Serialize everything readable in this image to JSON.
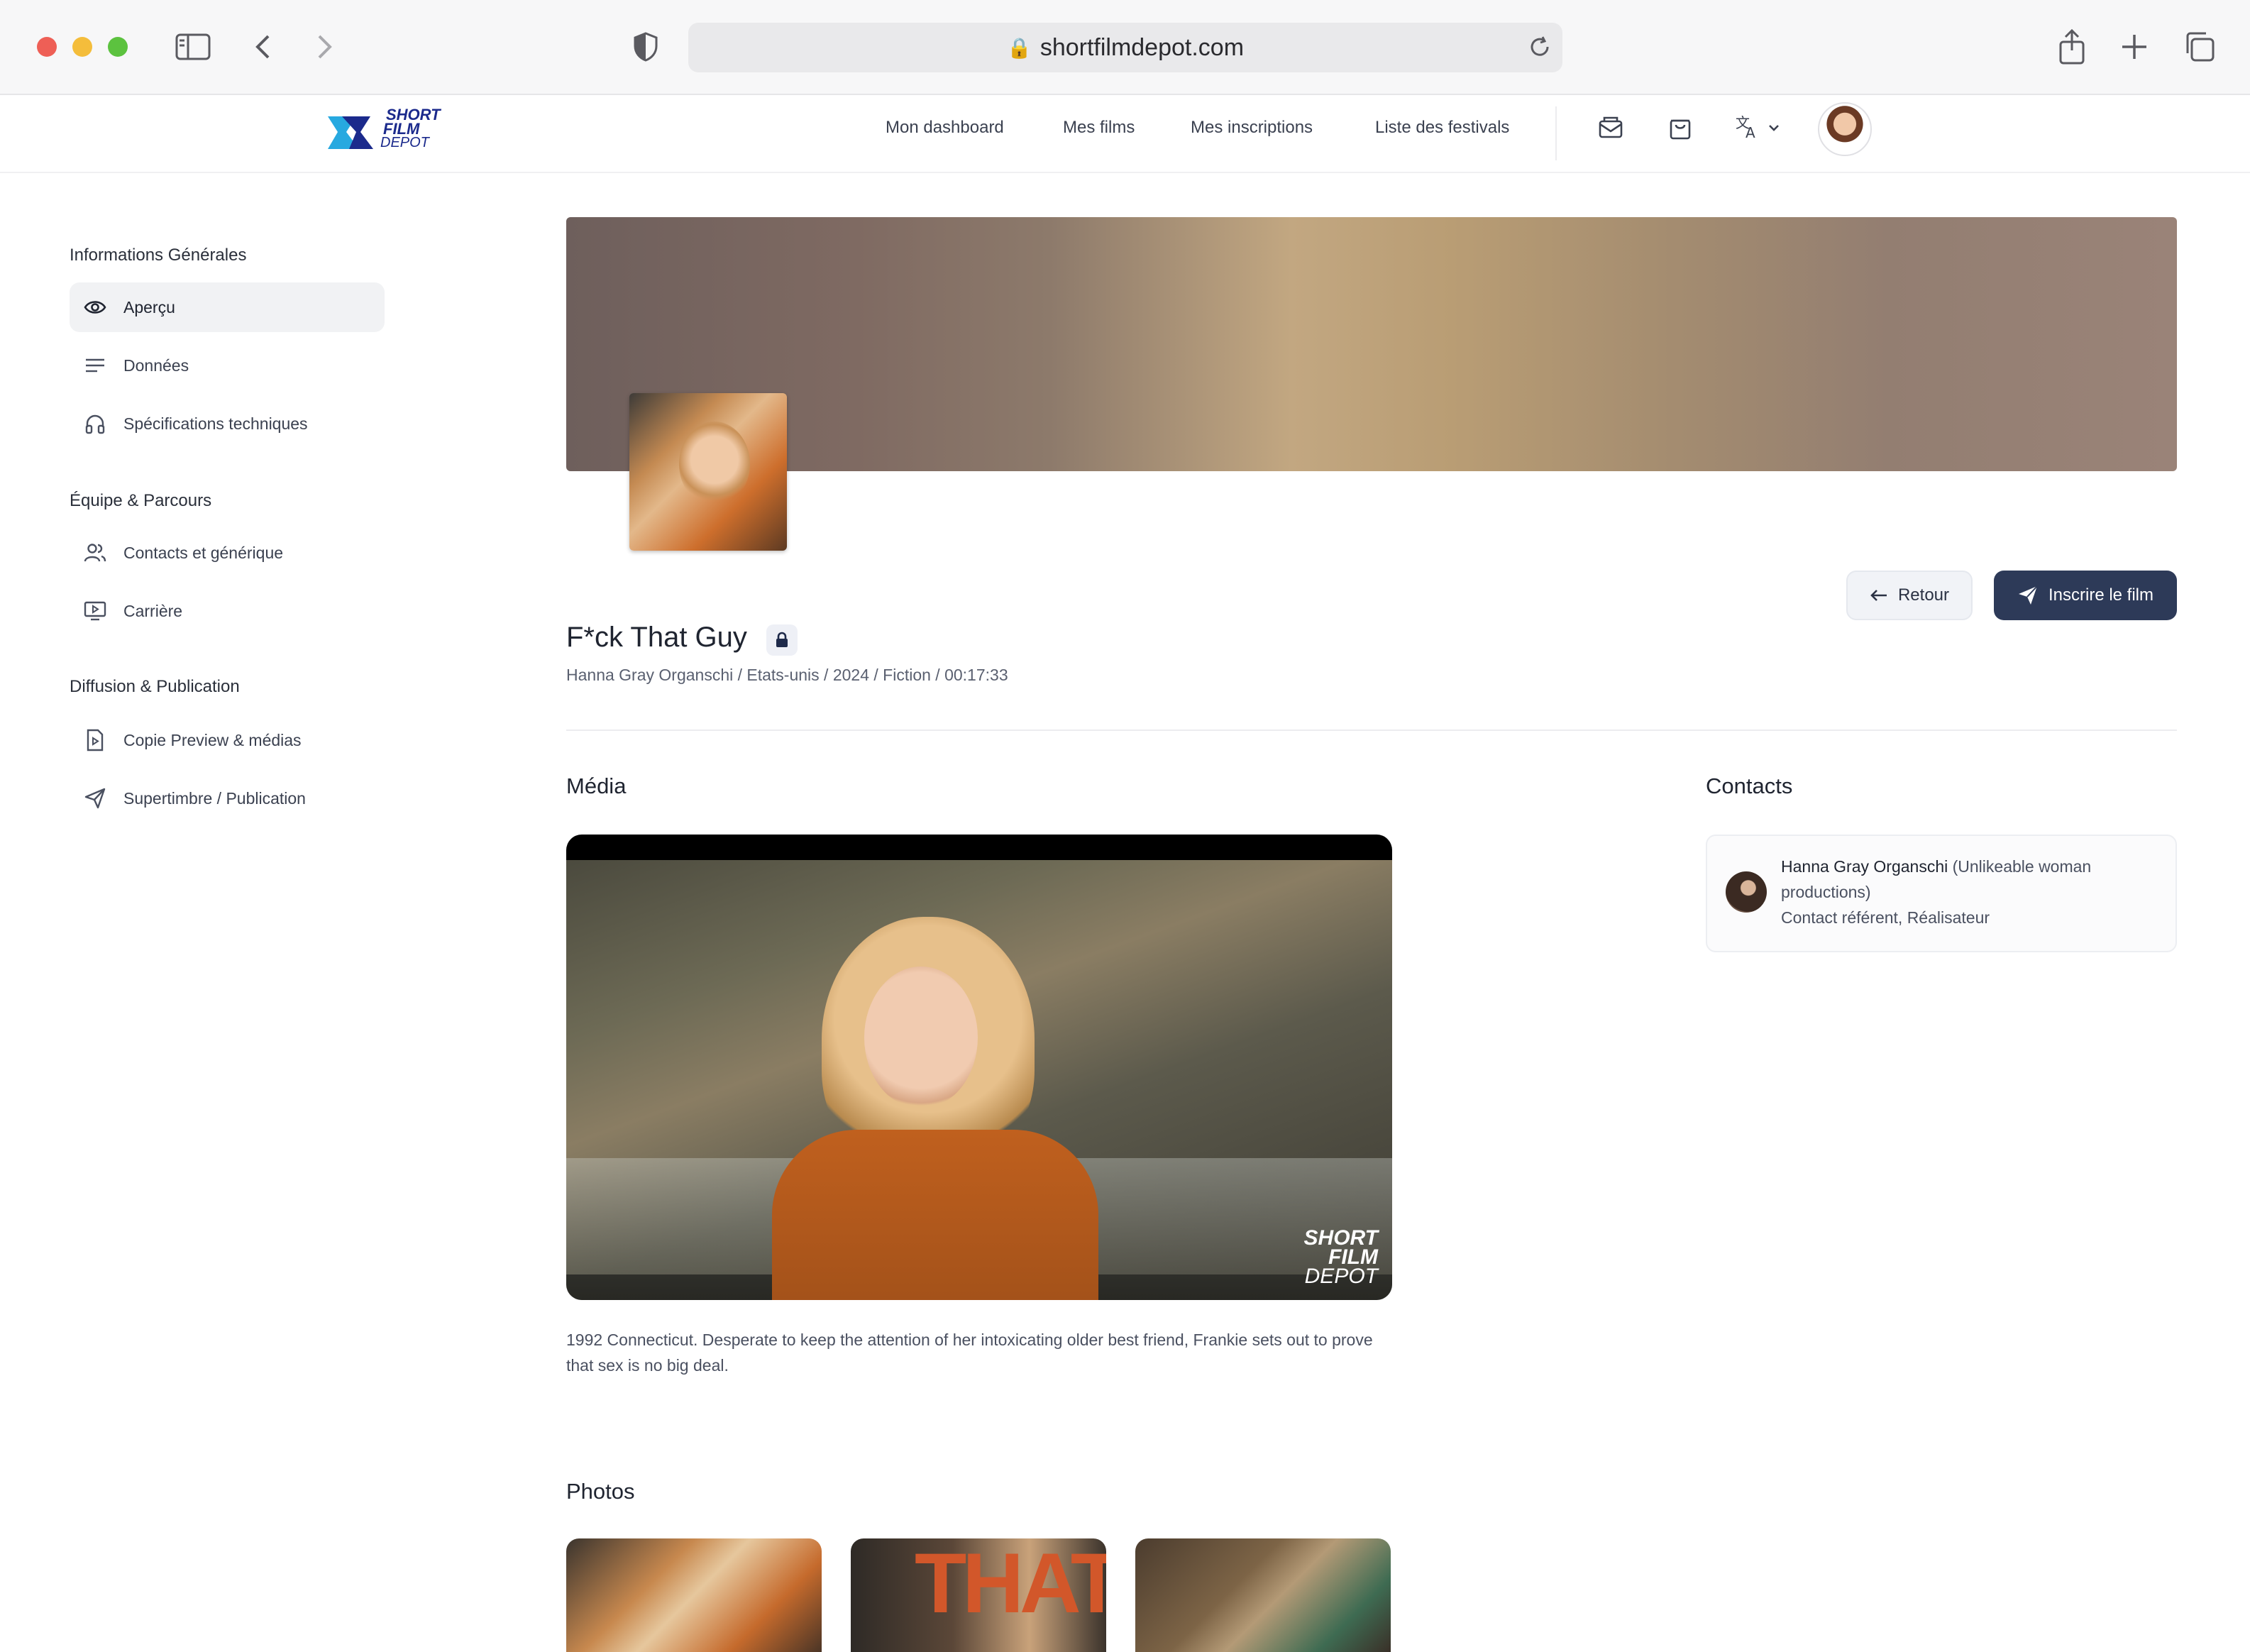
{
  "browser": {
    "url": "shortfilmdepot.com"
  },
  "header": {
    "logo": [
      "SHORT",
      "FILM",
      "DEPOT"
    ],
    "nav": [
      "Mon dashboard",
      "Mes films",
      "Mes inscriptions",
      "Liste des festivals"
    ]
  },
  "sidebar": {
    "sections": [
      {
        "title": "Informations Générales",
        "items": [
          {
            "label": "Aperçu",
            "icon": "eye-icon",
            "active": true
          },
          {
            "label": "Données",
            "icon": "lines-icon"
          },
          {
            "label": "Spécifications techniques",
            "icon": "headphones-icon"
          }
        ]
      },
      {
        "title": "Équipe & Parcours",
        "items": [
          {
            "label": "Contacts et générique",
            "icon": "users-icon"
          },
          {
            "label": "Carrière",
            "icon": "screen-play-icon"
          }
        ]
      },
      {
        "title": "Diffusion & Publication",
        "items": [
          {
            "label": "Copie Preview & médias",
            "icon": "file-play-icon"
          },
          {
            "label": "Supertimbre / Publication",
            "icon": "send-icon"
          }
        ]
      }
    ]
  },
  "film": {
    "title": "F*ck That Guy",
    "meta": "Hanna Gray Organschi / Etats-unis / 2024 / Fiction / 00:17:33",
    "synopsis": "1992 Connecticut. Desperate to keep the attention of her intoxicating older best friend, Frankie sets out to prove that sex is no big deal."
  },
  "actions": {
    "back": "Retour",
    "submit": "Inscrire le film"
  },
  "media": {
    "title": "Média",
    "watermark": [
      "SHORT",
      "FILM",
      "DEPOT"
    ]
  },
  "photos": {
    "title": "Photos",
    "photo2_text": "THAT"
  },
  "contacts": {
    "title": "Contacts",
    "name": "Hanna Gray Organschi",
    "company": "(Unlikeable woman",
    "company2": "productions)",
    "roles": "Contact référent, Réalisateur"
  }
}
